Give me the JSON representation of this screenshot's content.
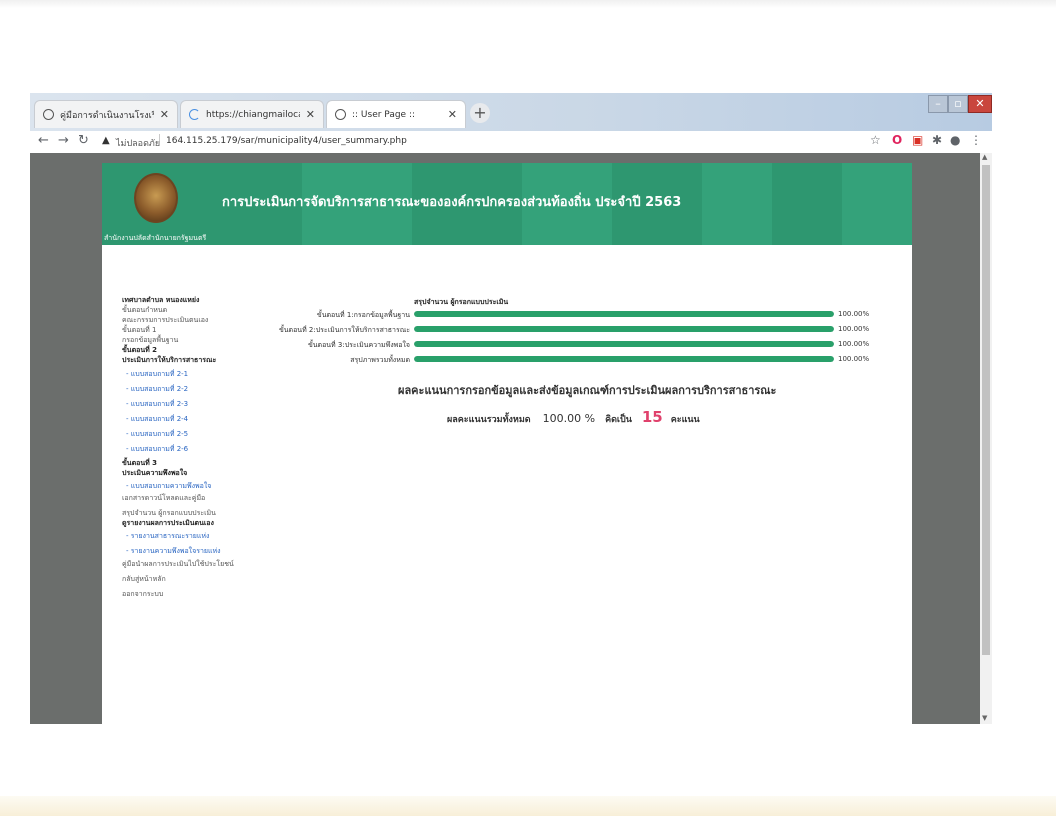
{
  "browser": {
    "tabs": [
      {
        "title": "คู่มือการดำเนินงานโรงเรียนผู้สูงอายุ"
      },
      {
        "title": "https://chiangmailocal.go.th"
      },
      {
        "title": ":: User Page ::"
      }
    ],
    "new_tab": "+",
    "address": {
      "insecure_label": "ไม่ปลอดภัย",
      "url": "164.115.25.179/sar/municipality4/user_summary.php"
    }
  },
  "header": {
    "title": "การประเมินการจัดบริการสาธารณะขององค์กรปกครองส่วนท้องถิ่น ประจำปี 2563",
    "subtitle": "สำนักงานปลัดสำนักนายกรัฐมนตรี"
  },
  "sidebar": {
    "org": "เทศบาลตำบล หนองแหย่ง",
    "items": [
      {
        "text": "ขั้นตอนกำหนด"
      },
      {
        "text": "คณะกรรมการประเมินตนเอง"
      },
      {
        "text": "ขั้นตอนที่ 1"
      },
      {
        "text": "กรอกข้อมูลพื้นฐาน"
      },
      {
        "text": "ขั้นตอนที่ 2"
      },
      {
        "text": "ประเมินการให้บริการสาธารณะ"
      },
      {
        "text": "- แบบสอบถามที่ 2-1"
      },
      {
        "text": "- แบบสอบถามที่ 2-2"
      },
      {
        "text": "- แบบสอบถามที่ 2-3"
      },
      {
        "text": "- แบบสอบถามที่ 2-4"
      },
      {
        "text": "- แบบสอบถามที่ 2-5"
      },
      {
        "text": "- แบบสอบถามที่ 2-6"
      },
      {
        "text": "ขั้นตอนที่ 3"
      },
      {
        "text": "ประเมินความพึงพอใจ"
      },
      {
        "text": "- แบบสอบถามความพึงพอใจ"
      },
      {
        "text": "เอกสารดาวน์โหลดและคู่มือ"
      },
      {
        "text": "สรุปจำนวน ผู้กรอกแบบประเมิน"
      },
      {
        "text": "ดูรายงานผลการประเมินตนเอง"
      },
      {
        "text": "- รายงานสาธารณะรายแห่ง"
      },
      {
        "text": "- รายงานความพึงพอใจรายแห่ง"
      },
      {
        "text": "คู่มือนำผลการประเมินไปใช้ประโยชน์"
      },
      {
        "text": "กลับสู่หน้าหลัก"
      },
      {
        "text": "ออกจากระบบ"
      }
    ]
  },
  "summary": {
    "title": "สรุปจำนวน ผู้กรอกแบบประเมิน",
    "rows": [
      {
        "label": "ขั้นตอนที่ 1:กรอกข้อมูลพื้นฐาน",
        "percent": 100,
        "percent_text": "100.00%"
      },
      {
        "label": "ขั้นตอนที่ 2:ประเมินการให้บริการสาธารณะ",
        "percent": 100,
        "percent_text": "100.00%"
      },
      {
        "label": "ขั้นตอนที่ 3:ประเมินความพึงพอใจ",
        "percent": 100,
        "percent_text": "100.00%"
      },
      {
        "label": "สรุปภาพรวมทั้งหมด",
        "percent": 100,
        "percent_text": "100.00%"
      }
    ]
  },
  "score": {
    "title": "ผลคะแนนการกรอกข้อมูลและส่งข้อมูลเกณฑ์การประเมินผลการบริการสาธารณะ",
    "total_label": "ผลคะแนนรวมทั้งหมด",
    "percent": "100.00 %",
    "equals_label": "คิดเป็น",
    "value": "15",
    "unit": "คะแนน"
  },
  "colors": {
    "header_green": "#2e9770",
    "bar_green": "#29a06a",
    "score_pink": "#e0416c",
    "link_blue": "#2a66c2"
  }
}
